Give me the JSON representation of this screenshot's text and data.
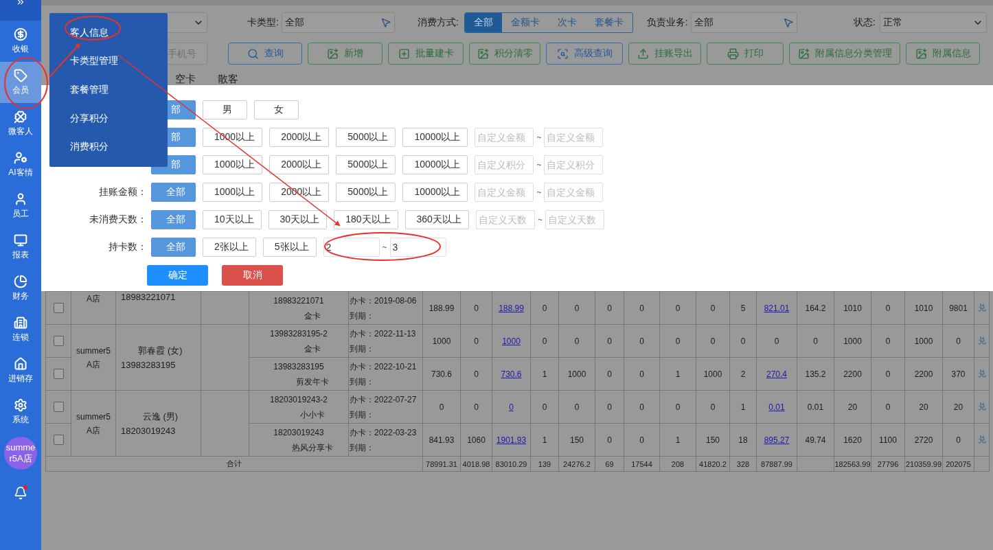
{
  "sidebar": {
    "items": [
      {
        "label": "收银",
        "selected": false
      },
      {
        "label": "会员",
        "selected": true
      },
      {
        "label": "微客人",
        "selected": false
      },
      {
        "label": "AI客情",
        "selected": false
      },
      {
        "label": "员工",
        "selected": false
      },
      {
        "label": "报表",
        "selected": false
      },
      {
        "label": "财务",
        "selected": false
      },
      {
        "label": "连锁",
        "selected": false
      },
      {
        "label": "进销存",
        "selected": false
      },
      {
        "label": "系统",
        "selected": false
      }
    ],
    "avatar": "summer5A店",
    "bell": {
      "unread": true
    }
  },
  "menu": {
    "items": [
      "客人信息",
      "卡类型管理",
      "套餐管理",
      "分享积分",
      "消费积分"
    ]
  },
  "toolbar": {
    "card_type": {
      "label": "卡类型:",
      "value": "全部"
    },
    "pay_mode": {
      "label": "消费方式:",
      "options": [
        {
          "label": "全部",
          "selected": true
        },
        {
          "label": "金额卡",
          "selected": false
        },
        {
          "label": "次卡",
          "selected": false
        },
        {
          "label": "套餐卡",
          "selected": false
        }
      ]
    },
    "staff": {
      "label": "负责业务:",
      "value": "全部"
    },
    "status": {
      "label": "状态:",
      "value": "正常"
    },
    "phone": {
      "placeholder": "手机号"
    },
    "buttons": [
      {
        "label": "查询",
        "kind": "primary"
      },
      {
        "label": "新增",
        "kind": "default"
      },
      {
        "label": "批量建卡",
        "kind": "default"
      },
      {
        "label": "积分清零",
        "kind": "default"
      },
      {
        "label": "高级查询",
        "kind": "primary"
      },
      {
        "label": "挂账导出",
        "kind": "default"
      },
      {
        "label": "打印",
        "kind": "default"
      },
      {
        "label": "附属信息分类管理",
        "kind": "default"
      },
      {
        "label": "附属信息",
        "kind": "default"
      }
    ]
  },
  "tabs": [
    "空卡",
    "散客"
  ],
  "filters": [
    {
      "options": [
        {
          "label": "部",
          "selected": true
        },
        {
          "label": "男",
          "selected": false
        },
        {
          "label": "女",
          "selected": false
        }
      ]
    },
    {
      "options": [
        {
          "label": "部",
          "selected": true
        },
        {
          "label": "1000以上",
          "selected": false
        },
        {
          "label": "2000以上",
          "selected": false
        },
        {
          "label": "5000以上",
          "selected": false
        },
        {
          "label": "10000以上",
          "selected": false
        }
      ],
      "range": [
        {
          "placeholder": "自定义金额"
        },
        {
          "placeholder": "自定义金额"
        }
      ],
      "separator": "~"
    },
    {
      "options": [
        {
          "label": "部",
          "selected": true
        },
        {
          "label": "1000以上",
          "selected": false
        },
        {
          "label": "2000以上",
          "selected": false
        },
        {
          "label": "5000以上",
          "selected": false
        },
        {
          "label": "10000以上",
          "selected": false
        }
      ],
      "range": [
        {
          "placeholder": "自定义积分"
        },
        {
          "placeholder": "自定义积分"
        }
      ],
      "separator": "~"
    },
    {
      "label": "挂账金额：",
      "options": [
        {
          "label": "全部",
          "selected": true
        },
        {
          "label": "1000以上",
          "selected": false
        },
        {
          "label": "2000以上",
          "selected": false
        },
        {
          "label": "5000以上",
          "selected": false
        },
        {
          "label": "10000以上",
          "selected": false
        }
      ],
      "range": [
        {
          "placeholder": "自定义金额"
        },
        {
          "placeholder": "自定义金额"
        }
      ],
      "separator": "~"
    },
    {
      "label": "未消费天数：",
      "options": [
        {
          "label": "全部",
          "selected": true
        },
        {
          "label": "10天以上",
          "selected": false
        },
        {
          "label": "30天以上",
          "selected": false
        },
        {
          "label": "180天以上",
          "selected": false
        },
        {
          "label": "360天以上",
          "selected": false
        }
      ],
      "range": [
        {
          "placeholder": "自定义天数"
        },
        {
          "placeholder": "自定义天数"
        }
      ],
      "separator": "~"
    },
    {
      "label": "持卡数：",
      "options": [
        {
          "label": "全部",
          "selected": true
        },
        {
          "label": "2张以上",
          "selected": false
        },
        {
          "label": "5张以上",
          "selected": false
        }
      ],
      "range": [
        {
          "value": "2"
        },
        {
          "value": "3"
        }
      ],
      "separator": "~"
    }
  ],
  "actions": [
    {
      "label": "确定",
      "kind": "confirm"
    },
    {
      "label": "取消",
      "kind": "cancel"
    }
  ],
  "table": {
    "groups": [
      {
        "store": "A店",
        "phone": "18983221071",
        "cards": [
          {
            "checked": false,
            "number": "18983221071",
            "type": "金卡",
            "opened": "办卡：2019-08-06",
            "expires": "到期：",
            "values": [
              {
                "text": "188.99"
              },
              {
                "text": "0"
              },
              {
                "text": "188.99",
                "link": true
              },
              {
                "text": "0"
              },
              {
                "text": "0"
              },
              {
                "text": "0"
              },
              {
                "text": "0"
              },
              {
                "text": "0"
              },
              {
                "text": "0"
              },
              {
                "text": "5"
              },
              {
                "text": "821.01",
                "link": true
              },
              {
                "text": "164.2"
              },
              {
                "text": "1010"
              },
              {
                "text": "0"
              },
              {
                "text": "1010"
              },
              {
                "text": "9801"
              }
            ],
            "action": "兑"
          }
        ]
      },
      {
        "store": "summer5\nA店",
        "name": "郭春霞 (女)",
        "phone": "13983283195",
        "cards": [
          {
            "checked": false,
            "number": "13983283195-2",
            "type": "金卡",
            "opened": "办卡：2022-11-13",
            "expires": "到期：",
            "values": [
              {
                "text": "1000"
              },
              {
                "text": "0"
              },
              {
                "text": "1000",
                "link": true
              },
              {
                "text": "0"
              },
              {
                "text": "0"
              },
              {
                "text": "0"
              },
              {
                "text": "0"
              },
              {
                "text": "0"
              },
              {
                "text": "0"
              },
              {
                "text": "0"
              },
              {
                "text": "0"
              },
              {
                "text": "0"
              },
              {
                "text": "1000"
              },
              {
                "text": "0"
              },
              {
                "text": "1000"
              },
              {
                "text": "0"
              }
            ],
            "action": "兑"
          },
          {
            "checked": false,
            "number": "13983283195",
            "type": "剪发年卡",
            "opened": "办卡：2022-10-21",
            "expires": "到期：",
            "values": [
              {
                "text": "730.6"
              },
              {
                "text": "0"
              },
              {
                "text": "730.6",
                "link": true
              },
              {
                "text": "1"
              },
              {
                "text": "1000"
              },
              {
                "text": "0"
              },
              {
                "text": "0"
              },
              {
                "text": "1"
              },
              {
                "text": "1000"
              },
              {
                "text": "2"
              },
              {
                "text": "270.4",
                "link": true
              },
              {
                "text": "135.2"
              },
              {
                "text": "2200"
              },
              {
                "text": "0"
              },
              {
                "text": "2200"
              },
              {
                "text": "370"
              }
            ],
            "action": "兑"
          }
        ]
      },
      {
        "store": "summer5\nA店",
        "name": "云逸 (男)",
        "phone": "18203019243",
        "cards": [
          {
            "checked": false,
            "number": "18203019243-2",
            "type": "小小卡",
            "opened": "办卡：2022-07-27",
            "expires": "到期：",
            "values": [
              {
                "text": "0"
              },
              {
                "text": "0"
              },
              {
                "text": "0",
                "link": true
              },
              {
                "text": "0"
              },
              {
                "text": "0"
              },
              {
                "text": "0"
              },
              {
                "text": "0"
              },
              {
                "text": "0"
              },
              {
                "text": "0"
              },
              {
                "text": "1"
              },
              {
                "text": "0.01",
                "link": true
              },
              {
                "text": "0.01"
              },
              {
                "text": "20"
              },
              {
                "text": "0"
              },
              {
                "text": "20"
              },
              {
                "text": "20"
              }
            ],
            "action": "兑"
          },
          {
            "checked": false,
            "number": "18203019243",
            "type": "热风分享卡",
            "opened": "办卡：2022-03-23",
            "expires": "到期：",
            "values": [
              {
                "text": "841.93"
              },
              {
                "text": "1060"
              },
              {
                "text": "1901.93",
                "link": true
              },
              {
                "text": "1"
              },
              {
                "text": "150"
              },
              {
                "text": "0"
              },
              {
                "text": "0"
              },
              {
                "text": "1"
              },
              {
                "text": "150"
              },
              {
                "text": "18"
              },
              {
                "text": "895.27",
                "link": true
              },
              {
                "text": "49.74"
              },
              {
                "text": "1620"
              },
              {
                "text": "1100"
              },
              {
                "text": "2720"
              },
              {
                "text": "0"
              }
            ],
            "action": "兑"
          }
        ]
      }
    ],
    "total": {
      "label": "合计",
      "values": [
        {
          "text": "78991.31"
        },
        {
          "text": "4018.98"
        },
        {
          "text": "83010.29"
        },
        {
          "text": "139"
        },
        {
          "text": "24276.2"
        },
        {
          "text": "69"
        },
        {
          "text": "17544"
        },
        {
          "text": "208"
        },
        {
          "text": "41820.2"
        },
        {
          "text": "328"
        },
        {
          "text": "87887.99"
        },
        {
          "blank": true
        },
        {
          "text": "182563.99"
        },
        {
          "text": "27796"
        },
        {
          "text": "210359.99"
        },
        {
          "text": "202075"
        }
      ]
    }
  }
}
